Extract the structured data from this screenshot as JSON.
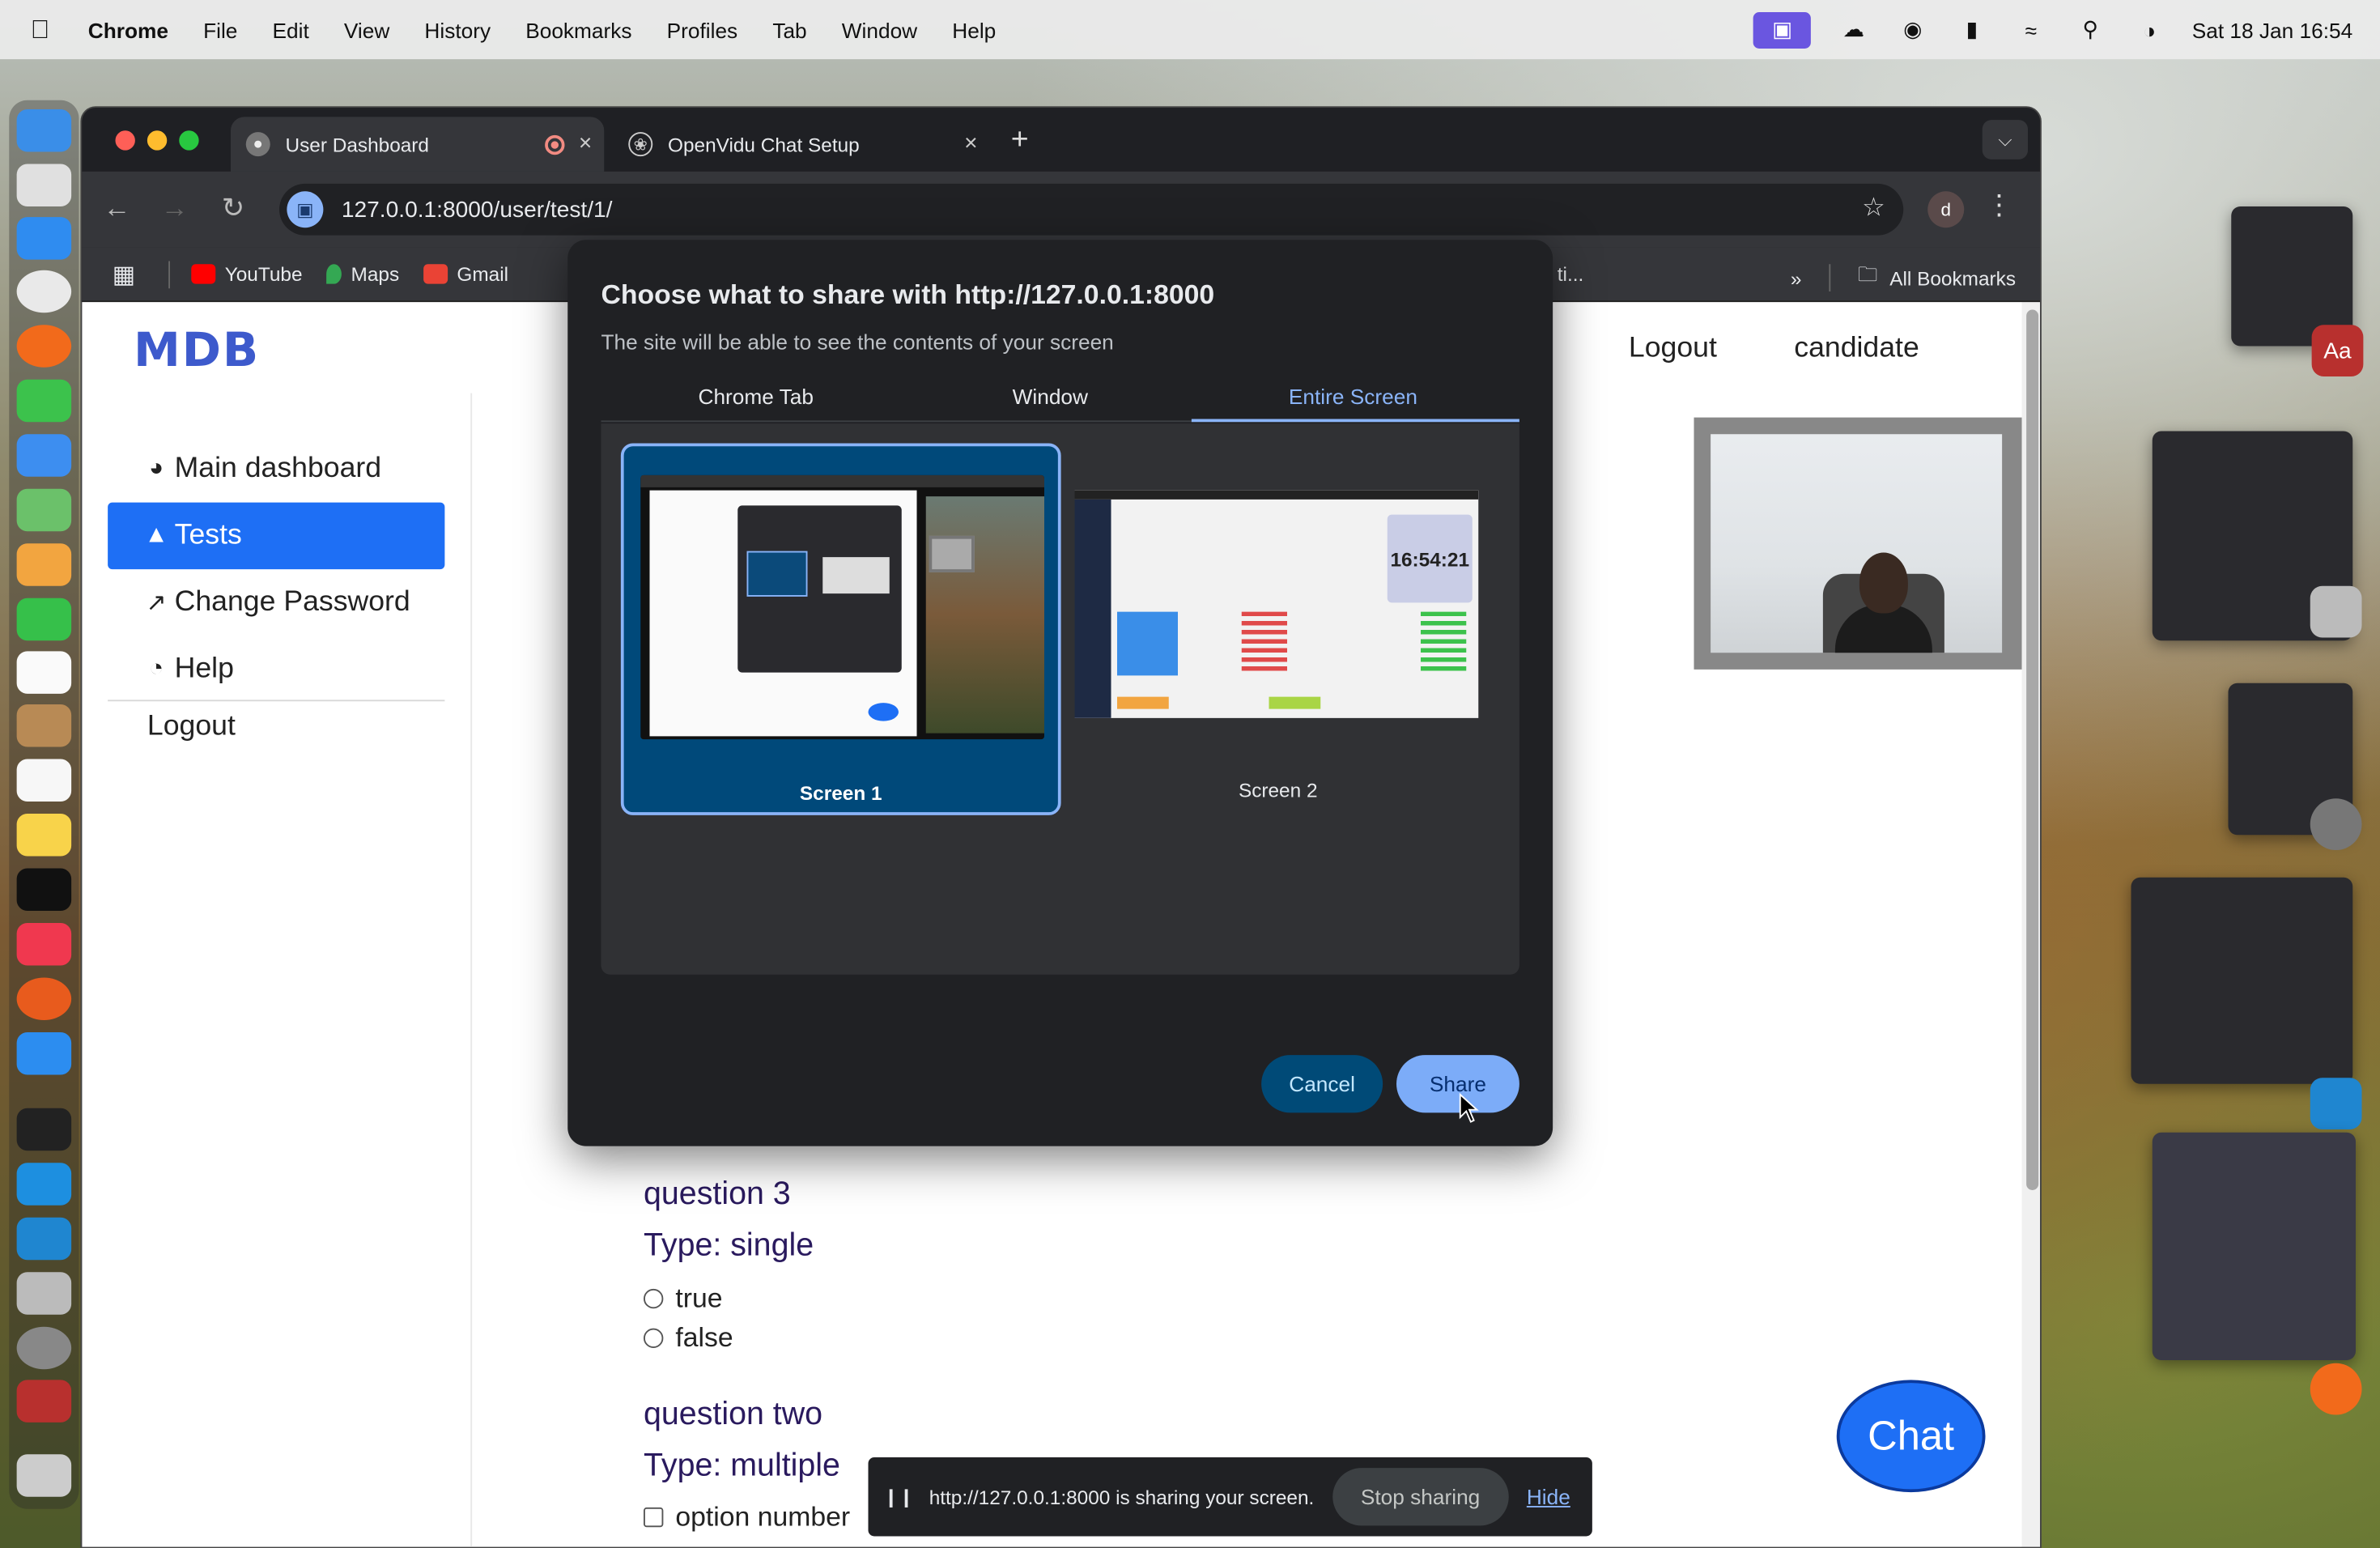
{
  "menubar": {
    "app": "Chrome",
    "items": [
      "File",
      "Edit",
      "View",
      "History",
      "Bookmarks",
      "Profiles",
      "Tab",
      "Window",
      "Help"
    ],
    "datetime": "Sat 18 Jan  16:54"
  },
  "browser": {
    "tabs": [
      {
        "title": "User Dashboard"
      },
      {
        "title": "OpenVidu Chat Setup"
      }
    ],
    "url": "127.0.0.1:8000/user/test/1/",
    "profile_initial": "d",
    "bookmarks": [
      "YouTube",
      "Maps",
      "Gmail"
    ],
    "bookmark_overflow_fragment": "ti...",
    "all_bookmarks": "All Bookmarks"
  },
  "page": {
    "logo": "MDB",
    "sidebar": [
      {
        "label": "Main dashboard",
        "icon": "gauge-icon"
      },
      {
        "label": "Tests",
        "icon": "chart-area-icon"
      },
      {
        "label": "Change Password",
        "icon": "chart-line-icon"
      },
      {
        "label": "Help",
        "icon": "pie-chart-icon"
      },
      {
        "label": "Logout",
        "icon": ""
      }
    ],
    "header_links": {
      "logout": "Logout",
      "user": "candidate"
    },
    "questions": [
      {
        "title": "question 3",
        "type": "Type: single",
        "options": [
          "true",
          "false"
        ]
      },
      {
        "title": "question two",
        "type": "Type: multiple",
        "options": [
          "option number"
        ]
      }
    ],
    "chat_button": "Chat"
  },
  "share_dialog": {
    "title": "Choose what to share with http://127.0.0.1:8000",
    "subtitle": "The site will be able to see the contents of your screen",
    "tabs": [
      "Chrome Tab",
      "Window",
      "Entire Screen"
    ],
    "selected_tab": "Entire Screen",
    "screens": [
      {
        "label": "Screen 1"
      },
      {
        "label": "Screen 2",
        "clock": "16:54:21"
      }
    ],
    "selected_screen": "Screen 1",
    "cancel": "Cancel",
    "share": "Share"
  },
  "sharing_bar": {
    "message": "http://127.0.0.1:8000 is sharing your screen.",
    "stop": "Stop sharing",
    "hide": "Hide"
  },
  "colors": {
    "accent": "#1e6ff5",
    "dialog_bg": "#202124",
    "dialog_accent": "#8ab4f8"
  }
}
